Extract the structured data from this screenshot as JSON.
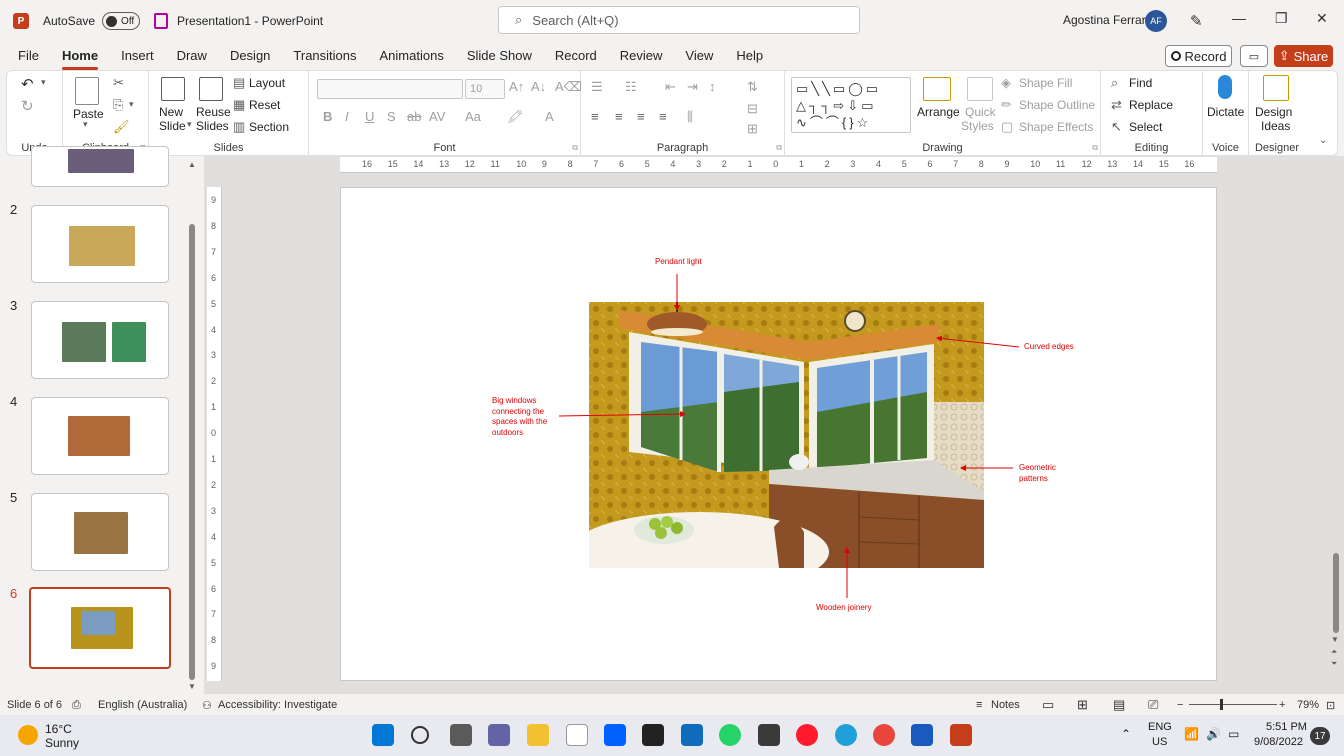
{
  "titlebar": {
    "autosave_label": "AutoSave",
    "autosave_state": "Off",
    "doc_title": "Presentation1  -  PowerPoint",
    "search_placeholder": "Search (Alt+Q)",
    "user_name": "Agostina Ferrari",
    "user_initials": "AF"
  },
  "menu": {
    "tabs": [
      "File",
      "Home",
      "Insert",
      "Draw",
      "Design",
      "Transitions",
      "Animations",
      "Slide Show",
      "Record",
      "Review",
      "View",
      "Help"
    ],
    "active_tab": "Home",
    "record_label": "Record",
    "share_label": "Share"
  },
  "ribbon": {
    "groups": {
      "undo": "Undo",
      "clipboard": "Clipboard",
      "slides": "Slides",
      "font": "Font",
      "paragraph": "Paragraph",
      "drawing": "Drawing",
      "editing": "Editing",
      "voice": "Voice",
      "designer": "Designer"
    },
    "paste": "Paste",
    "new_slide": "New",
    "new_slide_2": "Slide",
    "reuse_slides": "Reuse",
    "reuse_slides_2": "Slides",
    "layout": "Layout",
    "reset": "Reset",
    "section": "Section",
    "font_size": "10",
    "arrange": "Arrange",
    "quick_styles": "Quick",
    "quick_styles_2": "Styles",
    "shape_fill": "Shape Fill",
    "shape_outline": "Shape Outline",
    "shape_effects": "Shape Effects",
    "find": "Find",
    "replace": "Replace",
    "select": "Select",
    "dictate": "Dictate",
    "design_ideas": "Design",
    "design_ideas_2": "Ideas"
  },
  "thumbnails": {
    "numbers": [
      "2",
      "3",
      "4",
      "5",
      "6"
    ],
    "selected": "6"
  },
  "rulers": {
    "horizontal": [
      "16",
      "15",
      "14",
      "13",
      "12",
      "11",
      "10",
      "9",
      "8",
      "7",
      "6",
      "5",
      "4",
      "3",
      "2",
      "1",
      "0",
      "1",
      "2",
      "3",
      "4",
      "5",
      "6",
      "7",
      "8",
      "9",
      "10",
      "11",
      "12",
      "13",
      "14",
      "15",
      "16"
    ],
    "vertical": [
      "9",
      "8",
      "7",
      "6",
      "5",
      "4",
      "3",
      "2",
      "1",
      "0",
      "1",
      "2",
      "3",
      "4",
      "5",
      "6",
      "7",
      "8",
      "9"
    ]
  },
  "slide": {
    "annotations": {
      "pendant": "Pendant light",
      "curved": "Curved edges",
      "windows": "Big windows connecting the spaces with the outdoors",
      "geometric": "Geometric patterns",
      "joinery": "Wooden joinery"
    }
  },
  "status": {
    "slide_count": "Slide 6 of 6",
    "language": "English (Australia)",
    "accessibility": "Accessibility: Investigate",
    "notes": "Notes",
    "zoom": "79%"
  },
  "taskbar": {
    "temperature": "16°C",
    "weather": "Sunny",
    "lang_1": "ENG",
    "lang_2": "US",
    "time": "5:51 PM",
    "date": "9/08/2022",
    "notification_count": "17"
  },
  "colors": {
    "accent": "#c43e1c",
    "annotation": "#e00000"
  }
}
